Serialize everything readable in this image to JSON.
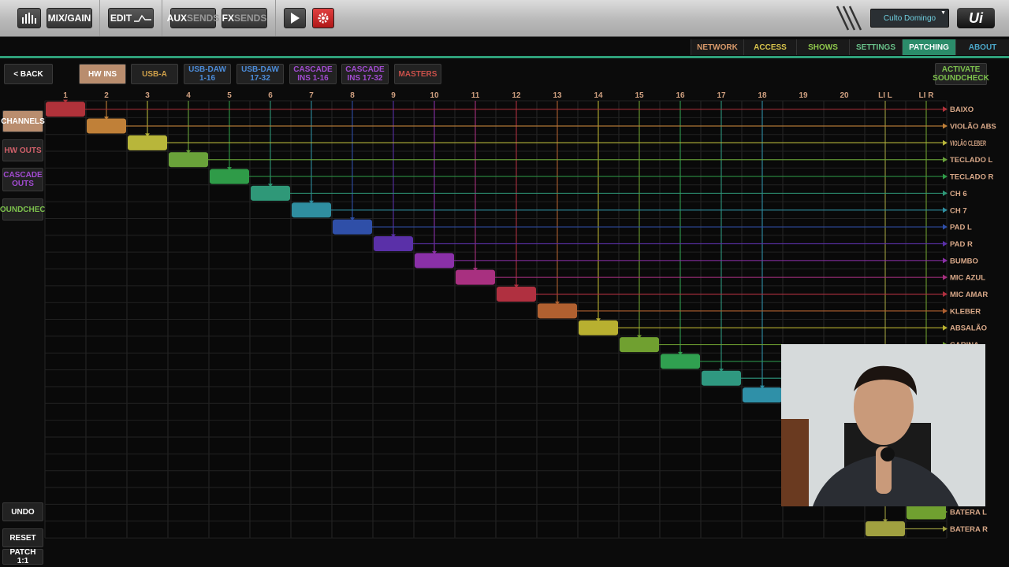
{
  "topbar": {
    "mixgain": "MIX/GAIN",
    "edit": "EDIT",
    "aux_a": "AUX",
    "aux_b": "SENDS",
    "fx_a": "FX",
    "fx_b": "SENDS",
    "show_name": "Culto Domingo",
    "logo": "Ui"
  },
  "menu": [
    {
      "label": "NETWORK",
      "color": "#d99a6b"
    },
    {
      "label": "ACCESS",
      "color": "#d8c44c"
    },
    {
      "label": "SHOWS",
      "color": "#8fc84c"
    },
    {
      "label": "SETTINGS",
      "color": "#69c28a"
    },
    {
      "label": "PATCHING",
      "color": "#ffffff",
      "active": true
    },
    {
      "label": "ABOUT",
      "color": "#4ba7c9"
    }
  ],
  "back_label": "< BACK",
  "activate": "ACTIVATE\nSOUNDCHECK",
  "source_tabs": [
    {
      "label": "HW INS",
      "color": "#ffffff",
      "active": true
    },
    {
      "label": "USB-A",
      "color": "#d0a14a"
    },
    {
      "label": "USB-DAW\n1-16",
      "color": "#4b8bd8"
    },
    {
      "label": "USB-DAW\n17-32",
      "color": "#4b8bd8"
    },
    {
      "label": "CASCADE\nINS 1-16",
      "color": "#a24bd1"
    },
    {
      "label": "CASCADE\nINS 17-32",
      "color": "#a24bd1"
    },
    {
      "label": "MASTERS",
      "color": "#c8504a"
    }
  ],
  "side_buttons": [
    {
      "label": "CHANNELS",
      "color": "#ffffff",
      "active": true
    },
    {
      "label": "HW OUTS",
      "color": "#d0606a"
    },
    {
      "label": "CASCADE\nOUTS",
      "color": "#a24bd1"
    },
    {
      "label": "SOUNDCHECK",
      "color": "#7cc04c"
    }
  ],
  "bottom_buttons": {
    "undo": "UNDO",
    "reset": "RESET",
    "patch": "PATCH 1:1"
  },
  "columns": [
    "1",
    "2",
    "3",
    "4",
    "5",
    "6",
    "7",
    "8",
    "9",
    "10",
    "11",
    "12",
    "13",
    "14",
    "15",
    "16",
    "17",
    "18",
    "19",
    "20",
    "LI L",
    "LI R"
  ],
  "rows": [
    "BAIXO",
    "VIOLÃO ABS",
    "VIOLÃO CLEBER",
    "TECLADO L",
    "TECLADO R",
    "CH 6",
    "CH 7",
    "PAD L",
    "PAD R",
    "BUMBO",
    "MIC AZUL",
    "MIC AMAR",
    "KLEBER",
    "ABSALÃO",
    "CARINA"
  ],
  "bottom_rows": [
    "BATERA L",
    "BATERA R"
  ],
  "patch": {
    "rows_col": [
      1,
      2,
      3,
      4,
      5,
      6,
      7,
      8,
      9,
      10,
      11,
      12,
      13,
      14,
      15,
      16,
      17,
      18
    ],
    "bottom": [
      {
        "row": "BATERA L",
        "col": 22
      },
      {
        "row": "BATERA R",
        "col": 21
      }
    ]
  },
  "colors": [
    "#b0323a",
    "#c08038",
    "#b8b63a",
    "#6aa23a",
    "#2f9b48",
    "#2f9878",
    "#2f8ea0",
    "#2f4fa8",
    "#5a30a8",
    "#8a30a8",
    "#a83080",
    "#b03040",
    "#b06030",
    "#b8b030",
    "#70a030",
    "#30a050",
    "#2f9880",
    "#2f90a8",
    "#3050b0",
    "#5030b0",
    "#a0a040",
    "#70a030"
  ]
}
